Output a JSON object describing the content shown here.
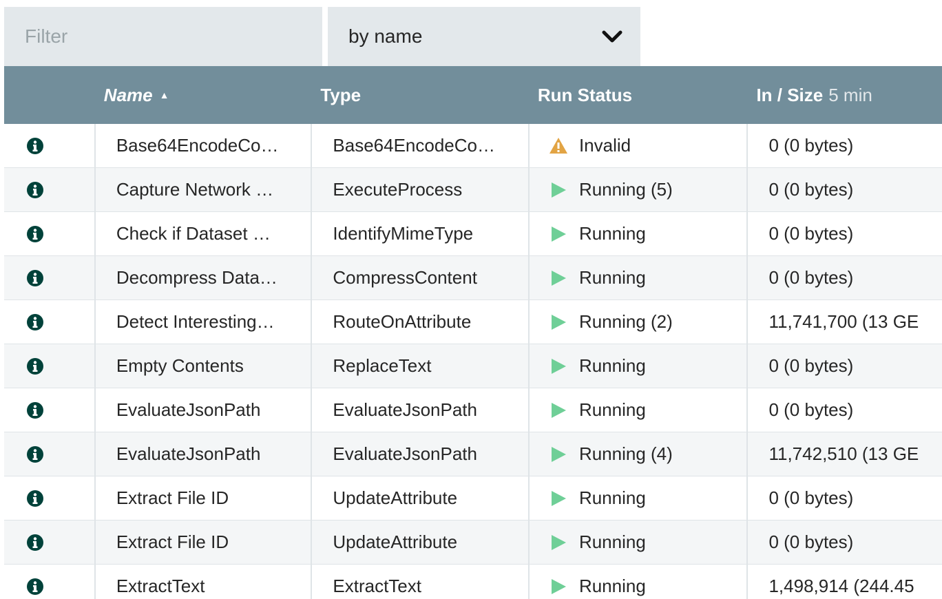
{
  "filter": {
    "placeholder": "Filter",
    "mode_selected": "by name",
    "mode_icon": "chevron-down-icon"
  },
  "columns": {
    "name": "Name",
    "type": "Type",
    "run_status": "Run Status",
    "in_size": "In / Size",
    "in_size_window": "5 min",
    "sort_direction": "ascending"
  },
  "colors": {
    "header_bg": "#728e9b",
    "running_green": "#6fcf97",
    "warning_orange": "#e2a444",
    "info_icon": "#00423a"
  },
  "rows": [
    {
      "name": "Base64EncodeCo…",
      "type": "Base64EncodeCo…",
      "status": "Invalid",
      "status_icon": "warning-icon",
      "in_size": "0 (0 bytes)"
    },
    {
      "name": "Capture Network …",
      "type": "ExecuteProcess",
      "status": "Running (5)",
      "status_icon": "play-icon",
      "in_size": "0 (0 bytes)"
    },
    {
      "name": "Check if Dataset …",
      "type": "IdentifyMimeType",
      "status": "Running",
      "status_icon": "play-icon",
      "in_size": "0 (0 bytes)"
    },
    {
      "name": "Decompress Data…",
      "type": "CompressContent",
      "status": "Running",
      "status_icon": "play-icon",
      "in_size": "0 (0 bytes)"
    },
    {
      "name": "Detect Interesting…",
      "type": "RouteOnAttribute",
      "status": "Running (2)",
      "status_icon": "play-icon",
      "in_size": "11,741,700 (13 GE"
    },
    {
      "name": "Empty Contents",
      "type": "ReplaceText",
      "status": "Running",
      "status_icon": "play-icon",
      "in_size": "0 (0 bytes)"
    },
    {
      "name": "EvaluateJsonPath",
      "type": "EvaluateJsonPath",
      "status": "Running",
      "status_icon": "play-icon",
      "in_size": "0 (0 bytes)"
    },
    {
      "name": "EvaluateJsonPath",
      "type": "EvaluateJsonPath",
      "status": "Running (4)",
      "status_icon": "play-icon",
      "in_size": "11,742,510 (13 GE"
    },
    {
      "name": "Extract File ID",
      "type": "UpdateAttribute",
      "status": "Running",
      "status_icon": "play-icon",
      "in_size": "0 (0 bytes)"
    },
    {
      "name": "Extract File ID",
      "type": "UpdateAttribute",
      "status": "Running",
      "status_icon": "play-icon",
      "in_size": "0 (0 bytes)"
    },
    {
      "name": "ExtractText",
      "type": "ExtractText",
      "status": "Running",
      "status_icon": "play-icon",
      "in_size": "1,498,914 (244.45"
    }
  ]
}
